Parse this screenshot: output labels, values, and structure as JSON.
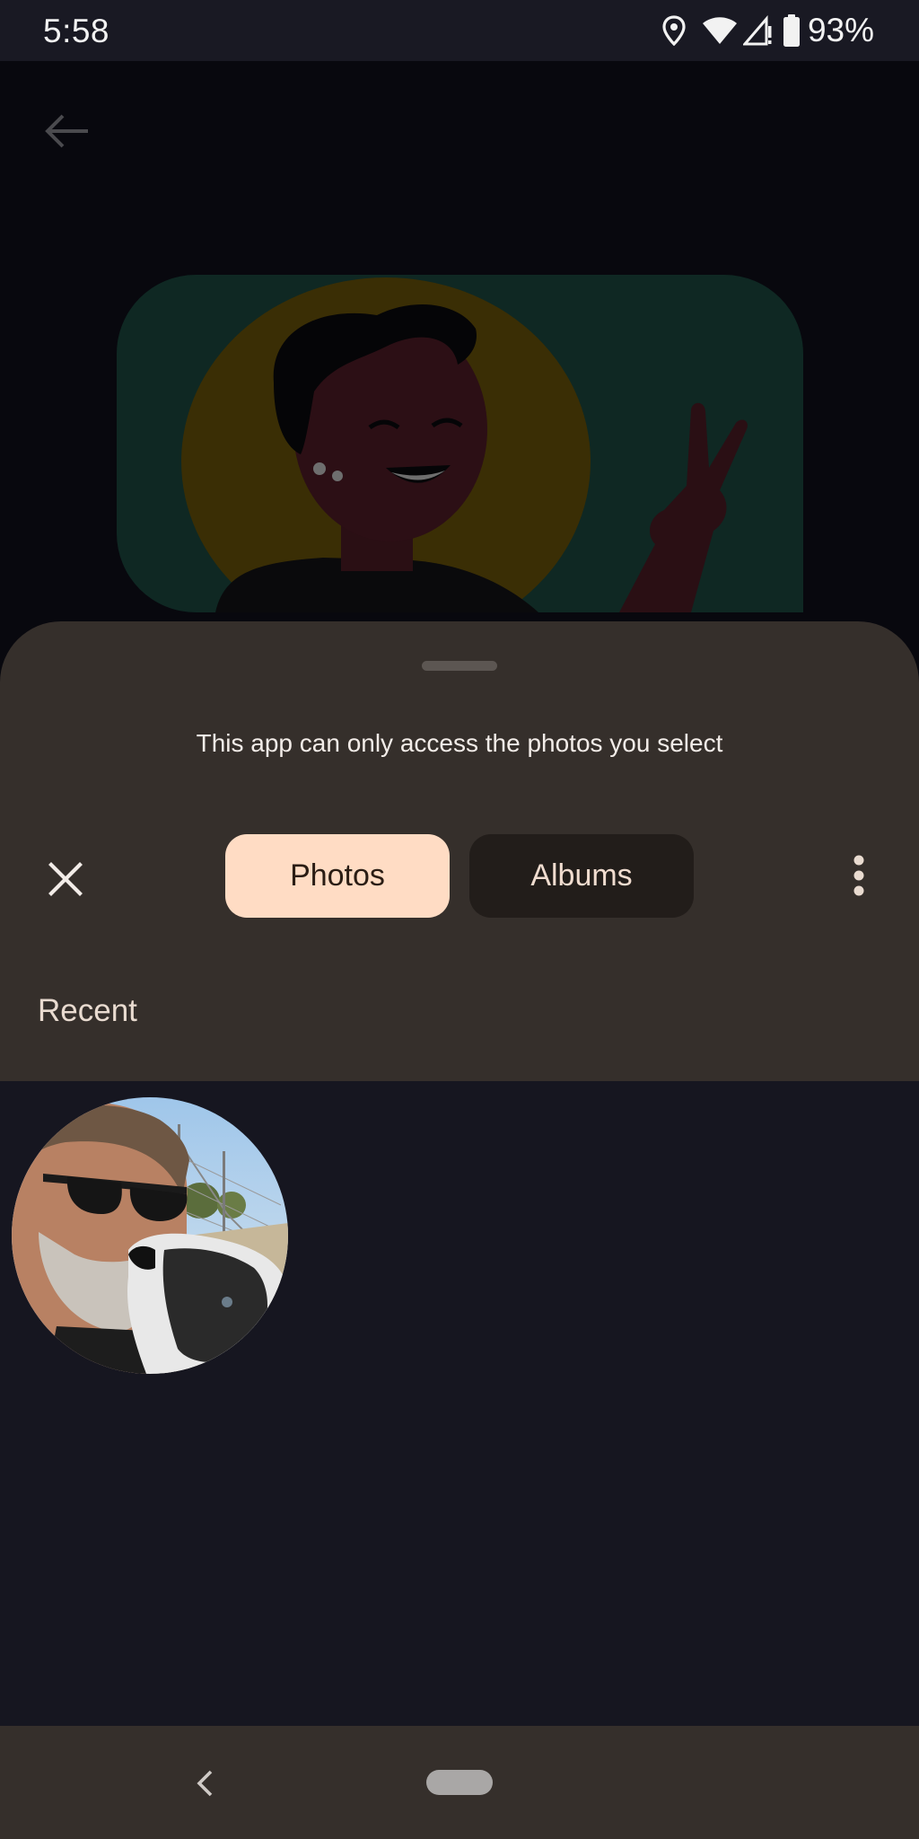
{
  "status_bar": {
    "time": "5:58",
    "battery": "93%",
    "icons": [
      "location-icon",
      "wifi-icon",
      "cell-signal-icon",
      "battery-icon"
    ]
  },
  "background": {
    "back_icon": "arrow-left-icon",
    "illustration": "person-waving-illustration"
  },
  "sheet": {
    "subtitle": "This app can only access the photos you select",
    "close_icon": "close-icon",
    "tabs": [
      {
        "label": "Photos",
        "selected": true
      },
      {
        "label": "Albums",
        "selected": false
      }
    ],
    "more_icon": "more-vert-icon",
    "section_title": "Recent"
  },
  "grid": {
    "items": [
      {
        "type": "photo",
        "description_icon": "photo-thumbnail"
      }
    ]
  },
  "nav_bar": {
    "back_icon": "nav-back-icon",
    "home_icon": "home-pill-icon"
  },
  "colors": {
    "sheet_bg": "#352f2b",
    "tab_selected_bg": "#ffdcc4",
    "tab_unselected_bg": "#221d1a",
    "grid_bg": "#161620"
  }
}
